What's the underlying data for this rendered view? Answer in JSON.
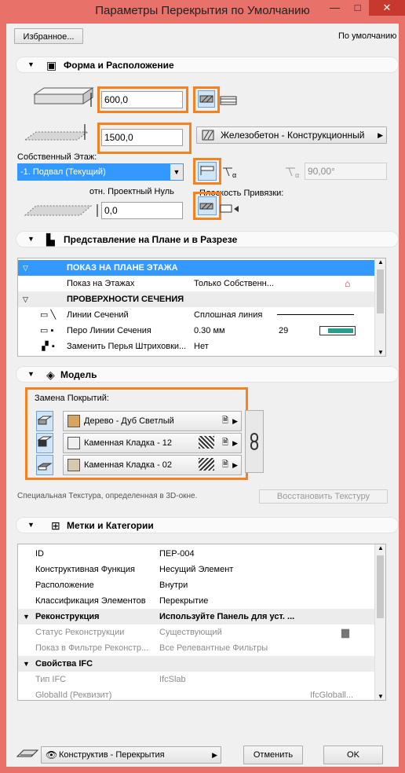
{
  "window": {
    "title": "Параметры Перекрытия по Умолчанию",
    "min": "—",
    "max": "□",
    "close": "✕"
  },
  "top": {
    "favorites": "Избранное...",
    "default": "По умолчанию"
  },
  "geometry": {
    "section_title": "Форма и Расположение",
    "thickness": "600,0",
    "offset": "1500,0",
    "material": "Железобетон - Конструкционный",
    "home_story_label": "Собственный Этаж:",
    "home_story": "-1. Подвал (Текущий)",
    "rel_label": "отн. Проектный Нуль",
    "rel_value": "0,0",
    "angle": "90,00°",
    "ref_plane_label": "Плоскость Привязки:"
  },
  "plan": {
    "section_title": "Представление на Плане и в Разрезе",
    "rows": [
      {
        "name": "ПОКАЗ НА ПЛАНЕ ЭТАЖА",
        "value": "",
        "extra": "",
        "group": true,
        "selected": true
      },
      {
        "name": "Показ на Этажах",
        "value": "Только Собственн...",
        "extra": "",
        "group": false
      },
      {
        "name": "ПРОВЕРХНОСТИ СЕЧЕНИЯ",
        "value": "",
        "extra": "",
        "group": true
      },
      {
        "name": "Линии Сечений",
        "value": "Сплошная линия",
        "extra": "",
        "group": false
      },
      {
        "name": "Перо Линии Сечения",
        "value": "0.30 мм",
        "extra": "29",
        "group": false
      },
      {
        "name": "Заменить Перья Штриховки...",
        "value": "Нет",
        "extra": "",
        "group": false
      }
    ]
  },
  "model": {
    "section_title": "Модель",
    "override_label": "Замена Покрытий:",
    "materials": [
      {
        "name": "Дерево - Дуб Светлый",
        "color": "#d9a45c"
      },
      {
        "name": "Каменная Кладка - 12",
        "color": "#efefef"
      },
      {
        "name": "Каменная Кладка - 02",
        "color": "#d8c8ad"
      }
    ],
    "texture_note": "Специальная Текстура, определенная в 3D-окне.",
    "restore": "Восстановить Текстуру"
  },
  "tags": {
    "section_title": "Метки и Категории",
    "rows": [
      {
        "name": "ID",
        "value": "ПЕР-004",
        "group": false,
        "dim": false
      },
      {
        "name": "Конструктивная Функция",
        "value": "Несущий Элемент",
        "group": false,
        "dim": false
      },
      {
        "name": "Расположение",
        "value": "Внутри",
        "group": false,
        "dim": false
      },
      {
        "name": "Классификация Элементов",
        "value": "Перекрытие",
        "group": false,
        "dim": false
      },
      {
        "name": "Реконструкция",
        "value": "Используйте Панель для уст. ...",
        "group": true,
        "dim": false
      },
      {
        "name": "Статус Реконструкции",
        "value": "Существующий",
        "group": false,
        "dim": true
      },
      {
        "name": "Показ в Фильтре Реконстр...",
        "value": "Все Релевантные Фильтры",
        "group": false,
        "dim": true
      },
      {
        "name": "Свойства IFC",
        "value": "",
        "group": true,
        "dim": false
      },
      {
        "name": "Тип IFC",
        "value": "IfcSlab",
        "group": false,
        "dim": true
      },
      {
        "name": "GlobalId (Реквизит)",
        "value": "",
        "extra": "IfcGloball...",
        "group": false,
        "dim": true
      }
    ]
  },
  "footer": {
    "layer": "Конструктив - Перекрытия",
    "cancel": "Отменить",
    "ok": "OK"
  }
}
